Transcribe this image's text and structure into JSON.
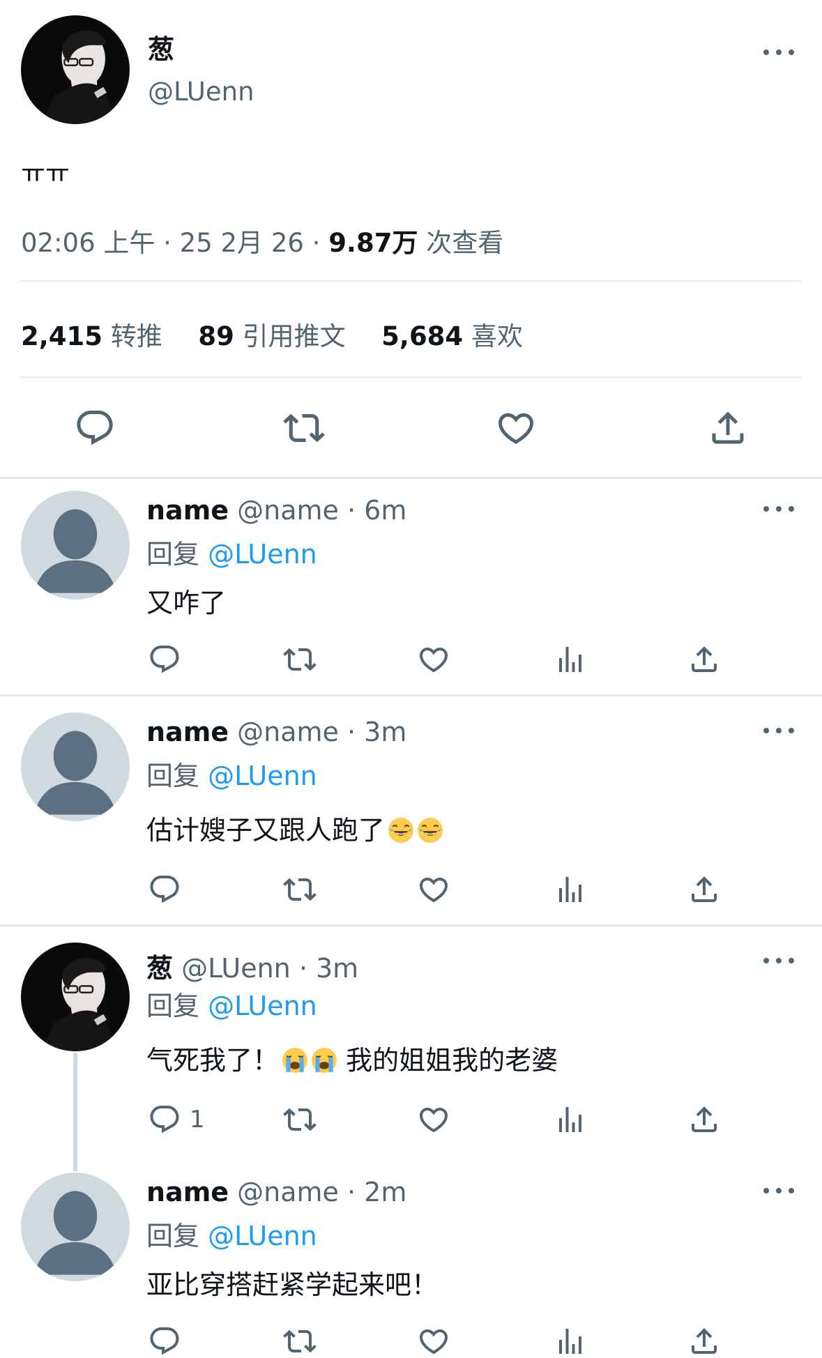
{
  "main_tweet": {
    "display_name": "葱",
    "handle": "@LUenn",
    "text": "ㅠㅠ",
    "timestamp": "02:06 上午 · 25 2月 26 ·",
    "views_count": "9.87万",
    "views_label": "次查看",
    "stats": {
      "retweets_count": "2,415",
      "retweets_label": "转推",
      "quotes_count": "89",
      "quotes_label": "引用推文",
      "likes_count": "5,684",
      "likes_label": "喜欢"
    }
  },
  "replies": [
    {
      "display_name": "name",
      "handle_time": "@name · 6m",
      "reply_prefix": "回复",
      "reply_to": "@LUenn",
      "text": "又咋了",
      "reply_count": ""
    },
    {
      "display_name": "name",
      "handle_time": "@name · 3m",
      "reply_prefix": "回复",
      "reply_to": "@LUenn",
      "text": "估计嫂子又跟人跑了",
      "reply_count": ""
    },
    {
      "display_name": "葱",
      "handle_time": "@LUenn · 3m",
      "reply_prefix": "回复",
      "reply_to": "@LUenn",
      "text_a": "气死我了！",
      "text_b": "我的姐姐我的老婆",
      "reply_count": "1"
    },
    {
      "display_name": "name",
      "handle_time": "@name · 2m",
      "reply_prefix": "回复",
      "reply_to": "@LUenn",
      "text": "亚比穿搭赶紧学起来吧！",
      "reply_count": ""
    }
  ],
  "icons": {
    "reply": "reply-icon",
    "retweet": "retweet-icon",
    "like": "heart-icon",
    "views": "views-icon",
    "share": "share-icon",
    "more": "more-icon"
  },
  "colors": {
    "link": "#1d9bf0",
    "muted": "#536471",
    "text": "#0f1419",
    "divider": "#e7e9ea"
  }
}
